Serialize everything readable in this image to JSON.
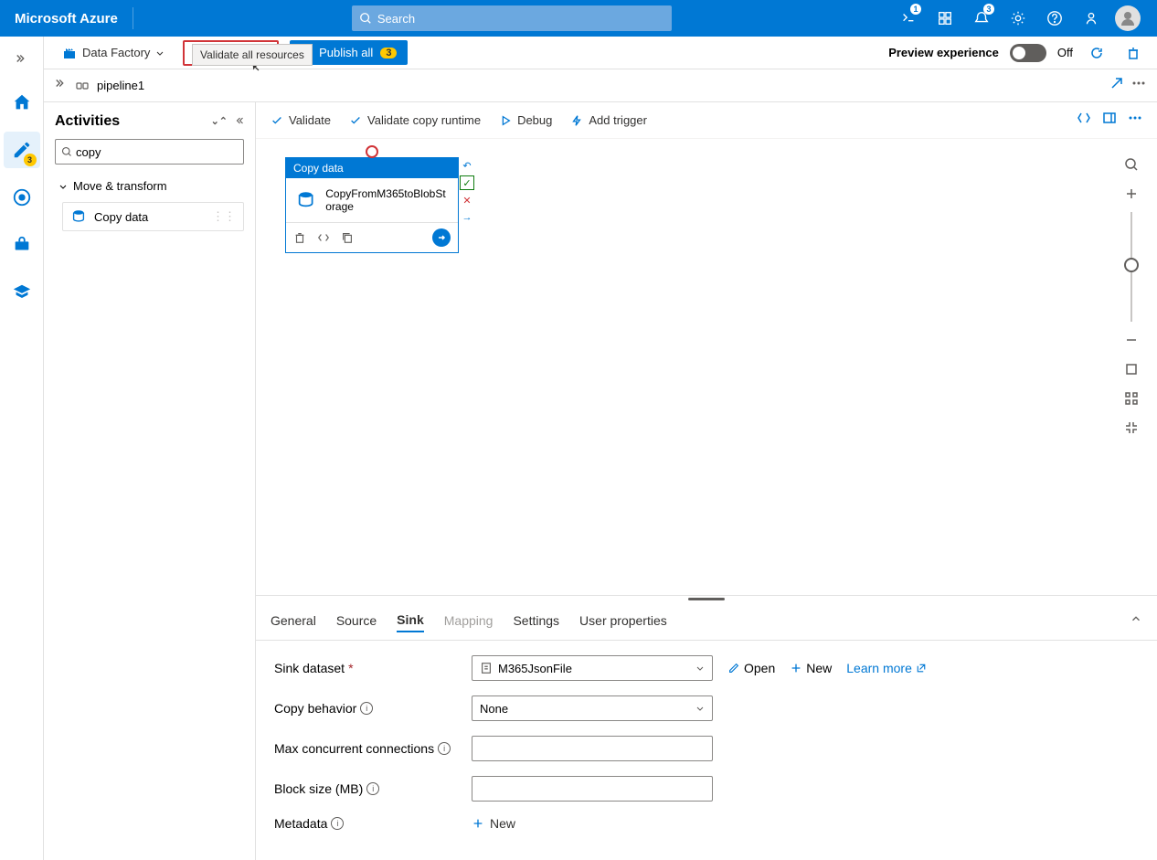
{
  "header": {
    "brand": "Microsoft Azure",
    "search_placeholder": "Search",
    "notification_badge_1": "1",
    "notification_badge_2": "3"
  },
  "left_rail": {
    "author_badge": "3"
  },
  "toolbar": {
    "resource_label": "Data Factory",
    "validate_all": "Validate all",
    "publish_all": "Publish all",
    "publish_badge": "3",
    "preview_label": "Preview experience",
    "preview_state": "Off"
  },
  "breadcrumb": {
    "pipeline": "pipeline1"
  },
  "tooltip": {
    "validate_all": "Validate all resources"
  },
  "activities": {
    "title": "Activities",
    "search_value": "copy",
    "group": "Move & transform",
    "item": "Copy data"
  },
  "canvas_toolbar": {
    "validate": "Validate",
    "validate_runtime": "Validate copy runtime",
    "debug": "Debug",
    "add_trigger": "Add trigger"
  },
  "node": {
    "header": "Copy data",
    "name": "CopyFromM365toBlobStorage"
  },
  "props": {
    "tabs": {
      "general": "General",
      "source": "Source",
      "sink": "Sink",
      "mapping": "Mapping",
      "settings": "Settings",
      "user_properties": "User properties"
    },
    "sink_dataset_label": "Sink dataset",
    "sink_dataset_value": "M365JsonFile",
    "open": "Open",
    "new": "New",
    "learn_more": "Learn more",
    "copy_behavior_label": "Copy behavior",
    "copy_behavior_value": "None",
    "max_conn_label": "Max concurrent connections",
    "block_size_label": "Block size (MB)",
    "metadata_label": "Metadata",
    "metadata_new": "New"
  }
}
